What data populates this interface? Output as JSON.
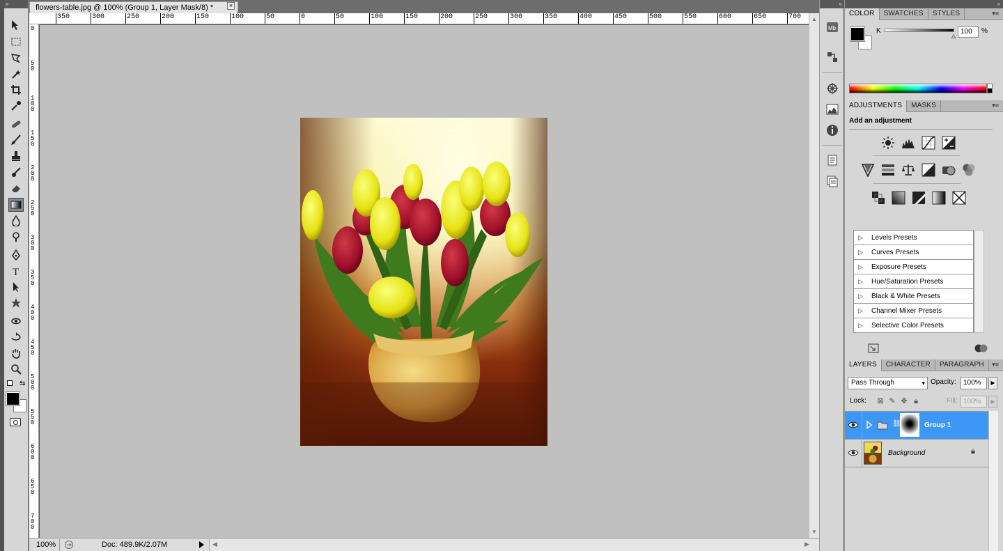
{
  "document": {
    "tab_title": "flowers-table.jpg @ 100% (Group 1, Layer Mask/8) *",
    "close_glyph": "×",
    "ruler_top_labels": [
      "350",
      "300",
      "250",
      "200",
      "150",
      "100",
      "50",
      "0",
      "50",
      "100",
      "150",
      "200",
      "250",
      "300",
      "350",
      "400",
      "450",
      "500",
      "550",
      "600",
      "650",
      "700"
    ],
    "ruler_left_labels": [
      "0",
      "5 0",
      "1 0 0",
      "1 5 0",
      "2 0 0",
      "2 5 0",
      "3 0 0",
      "3 5 0",
      "4 0 0",
      "4 5 0",
      "5 0 0",
      "5 5 0",
      "6 0 0",
      "6 5 0",
      "7 0 0"
    ],
    "zoom": "100%",
    "doc_info": "Doc: 489.9K/2.07M"
  },
  "color_panel": {
    "tabs": [
      "COLOR",
      "SWATCHES",
      "STYLES"
    ],
    "channel_label": "K",
    "channel_value": "100",
    "percent": "%"
  },
  "adjustments_panel": {
    "tabs": [
      "ADJUSTMENTS",
      "MASKS"
    ],
    "title": "Add an adjustment",
    "presets": [
      "Levels Presets",
      "Curves Presets",
      "Exposure Presets",
      "Hue/Saturation Presets",
      "Black & White Presets",
      "Channel Mixer Presets",
      "Selective Color Presets"
    ]
  },
  "layers_panel": {
    "tabs": [
      "LAYERS",
      "CHARACTER",
      "PARAGRAPH"
    ],
    "blend_mode": "Pass Through",
    "opacity_label": "Opacity:",
    "opacity_value": "100%",
    "lock_label": "Lock:",
    "fill_label": "Fill:",
    "fill_value": "100%",
    "layers": [
      {
        "name": "Group 1",
        "selected": true
      },
      {
        "name": "Background",
        "selected": false
      }
    ]
  },
  "colors": {
    "selection": "#3d97f5",
    "canvas": "#c0c0c0"
  }
}
